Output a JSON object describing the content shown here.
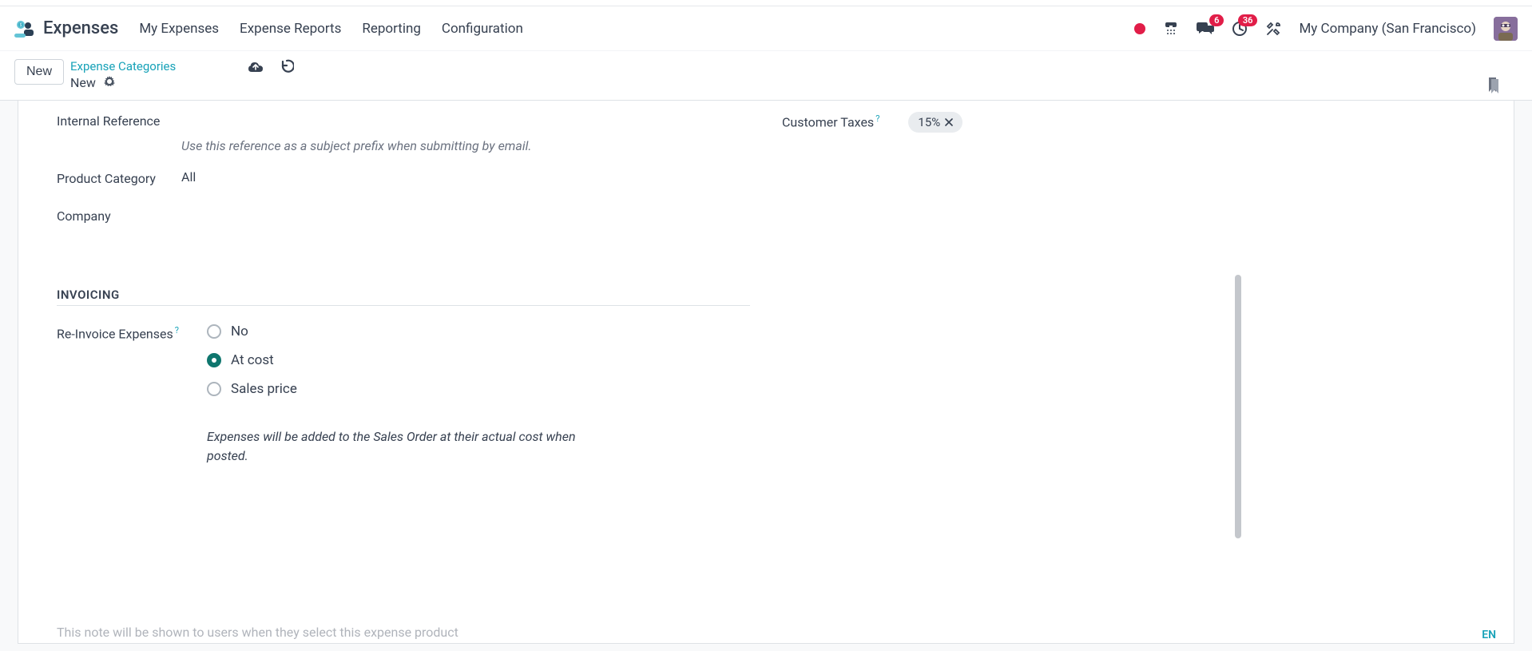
{
  "nav": {
    "brand": "Expenses",
    "items": [
      "My Expenses",
      "Expense Reports",
      "Reporting",
      "Configuration"
    ]
  },
  "systray": {
    "chat_badge": "6",
    "clock_badge": "36",
    "company": "My Company (San Francisco)"
  },
  "subheader": {
    "new_btn": "New",
    "breadcrumb_link": "Expense Categories",
    "breadcrumb_current": "New"
  },
  "fields": {
    "internal_ref_label": "Internal Reference",
    "internal_ref_help": "Use this reference as a subject prefix when submitting by email.",
    "product_category_label": "Product Category",
    "product_category_value": "All",
    "company_label": "Company",
    "customer_taxes_label": "Customer Taxes",
    "tax_tag": "15%"
  },
  "invoicing": {
    "section_title": "INVOICING",
    "reinvoice_label": "Re-Invoice Expenses",
    "options": {
      "no": "No",
      "at_cost": "At cost",
      "sales_price": "Sales price"
    },
    "help": "Expenses will be added to the Sales Order at their actual cost when posted."
  },
  "footer": {
    "note_placeholder": "This note will be shown to users when they select this expense product",
    "lang": "EN"
  }
}
